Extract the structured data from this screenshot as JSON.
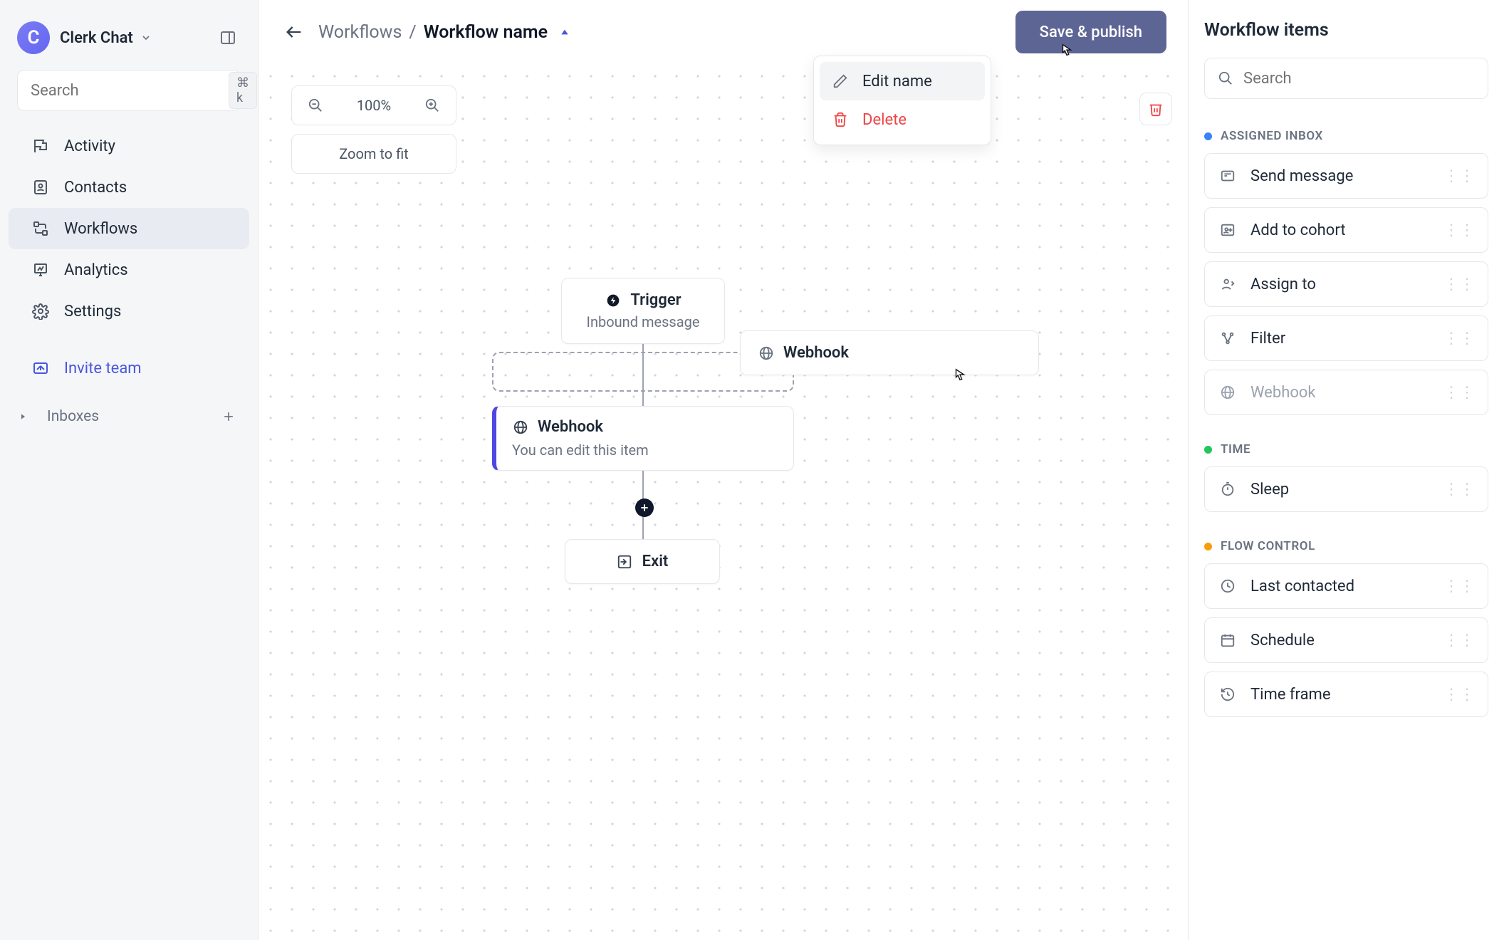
{
  "brand": {
    "name": "Clerk Chat",
    "logo_letter": "C"
  },
  "sidebar": {
    "search_placeholder": "Search",
    "shortcut": "⌘ k",
    "nav": [
      {
        "label": "Activity"
      },
      {
        "label": "Contacts"
      },
      {
        "label": "Workflows"
      },
      {
        "label": "Analytics"
      },
      {
        "label": "Settings"
      }
    ],
    "invite_label": "Invite team",
    "inboxes_label": "Inboxes"
  },
  "toolbar": {
    "back_crumb": "Workflows",
    "sep": "/",
    "current": "Workflow name",
    "save_label": "Save & publish"
  },
  "dropdown": {
    "edit": "Edit name",
    "delete": "Delete"
  },
  "zoom": {
    "level": "100%",
    "fit": "Zoom to fit"
  },
  "canvas": {
    "trigger_title": "Trigger",
    "trigger_sub": "Inbound message",
    "dragging_label": "Webhook",
    "webhook_title": "Webhook",
    "webhook_sub": "You can edit this item",
    "exit_label": "Exit"
  },
  "panel": {
    "title": "Workflow items",
    "search_placeholder": "Search",
    "cat_inbox": "ASSIGNED INBOX",
    "cat_time": "TIME",
    "cat_flow": "FLOW CONTROL",
    "items_inbox": [
      "Send message",
      "Add to cohort",
      "Assign to",
      "Filter",
      "Webhook"
    ],
    "items_time": [
      "Sleep"
    ],
    "items_flow": [
      "Last contacted",
      "Schedule",
      "Time frame"
    ]
  }
}
